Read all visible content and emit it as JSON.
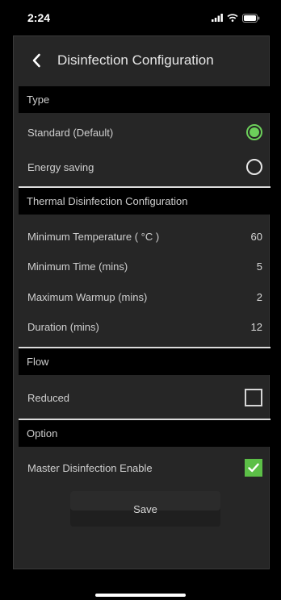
{
  "status_bar": {
    "time": "2:24"
  },
  "header": {
    "title": "Disinfection Configuration"
  },
  "sections": {
    "type": {
      "title": "Type",
      "options": [
        {
          "label": "Standard (Default)",
          "selected": true
        },
        {
          "label": "Energy saving",
          "selected": false
        }
      ]
    },
    "thermal": {
      "title": "Thermal Disinfection Configuration",
      "rows": [
        {
          "label": "Minimum Temperature ( °C )",
          "value": "60"
        },
        {
          "label": "Minimum Time (mins)",
          "value": "5"
        },
        {
          "label": "Maximum Warmup (mins)",
          "value": "2"
        },
        {
          "label": "Duration (mins)",
          "value": "12"
        }
      ]
    },
    "flow": {
      "title": "Flow",
      "reduced_label": "Reduced",
      "reduced_checked": false
    },
    "option": {
      "title": "Option",
      "master_label": "Master Disinfection Enable",
      "master_checked": true
    }
  },
  "save_label": "Save",
  "colors": {
    "accent_green": "#6ccf5a",
    "checkbox_green": "#5cbf47",
    "panel_bg": "#262626",
    "section_bg": "#000000"
  }
}
